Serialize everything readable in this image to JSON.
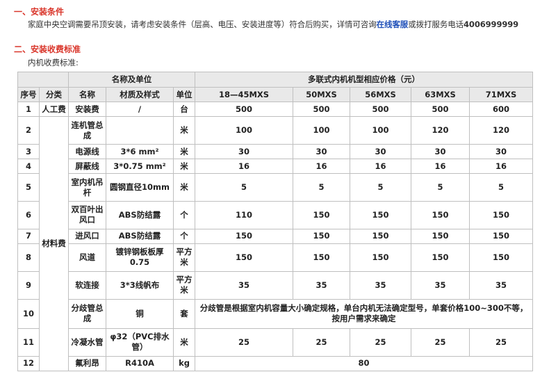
{
  "section1": {
    "title": "一、安装条件"
  },
  "intro": {
    "text_before": "家庭中央空调需要吊顶安装，请考虑安装条件（层高、电压、安装进度等）符合后购买，详情可咨询",
    "link": "在线客服",
    "text_after": "或拨打服务电话",
    "phone": "4006999999"
  },
  "section2": {
    "title": "二、安装收费标准"
  },
  "subtitle": "内机收费标准:",
  "table": {
    "group_name_unit": "名称及单位",
    "group_price": "多联式内机机型相应价格（元）",
    "headers": [
      "序号",
      "分类",
      "名称",
      "材质及样式",
      "单位"
    ],
    "models": [
      "18—45MXS",
      "50MXS",
      "56MXS",
      "63MXS",
      "71MXS"
    ],
    "cat_labor": "人工费",
    "cat_material": "材料费",
    "rows": [
      {
        "no": "1",
        "name": "安装费",
        "material": "/",
        "unit": "台",
        "prices": [
          "500",
          "500",
          "500",
          "500",
          "600"
        ]
      },
      {
        "no": "2",
        "name": "连机管总成",
        "material": "",
        "unit": "米",
        "prices": [
          "100",
          "100",
          "100",
          "120",
          "120"
        ]
      },
      {
        "no": "3",
        "name": "电源线",
        "material": "3*6 mm²",
        "unit": "米",
        "prices": [
          "30",
          "30",
          "30",
          "30",
          "30"
        ]
      },
      {
        "no": "4",
        "name": "屏蔽线",
        "material": "3*0.75 mm²",
        "unit": "米",
        "prices": [
          "16",
          "16",
          "16",
          "16",
          "16"
        ]
      },
      {
        "no": "5",
        "name": "室内机吊杆",
        "material": "圆钢直径10mm",
        "unit": "米",
        "prices": [
          "5",
          "5",
          "5",
          "5",
          "5"
        ]
      },
      {
        "no": "6",
        "name": "双百叶出风口",
        "material": "ABS防结露",
        "unit": "个",
        "prices": [
          "110",
          "150",
          "150",
          "150",
          "150"
        ]
      },
      {
        "no": "7",
        "name": "进风口",
        "material": "ABS防结露",
        "unit": "个",
        "prices": [
          "150",
          "150",
          "150",
          "150",
          "150"
        ]
      },
      {
        "no": "8",
        "name": "风道",
        "material": "镀锌钢板板厚0.75",
        "unit": "平方米",
        "prices": [
          "150",
          "150",
          "150",
          "150",
          "150"
        ]
      },
      {
        "no": "9",
        "name": "软连接",
        "material": "3*3线帆布",
        "unit": "平方米",
        "prices": [
          "35",
          "35",
          "35",
          "35",
          "35"
        ]
      },
      {
        "no": "10",
        "name": "分歧管总成",
        "material": "铜",
        "unit": "套",
        "note": "分歧管是根据室内机容量大小确定规格，单台内机无法确定型号，单套价格100~300不等，按用户需求来确定"
      },
      {
        "no": "11",
        "name": "冷凝水管",
        "material": "φ32（PVC排水管）",
        "unit": "米",
        "prices": [
          "25",
          "25",
          "25",
          "25",
          "25"
        ]
      },
      {
        "no": "12",
        "name": "氟利昂",
        "material": "R410A",
        "unit": "kg",
        "merged_price": "80"
      }
    ]
  }
}
